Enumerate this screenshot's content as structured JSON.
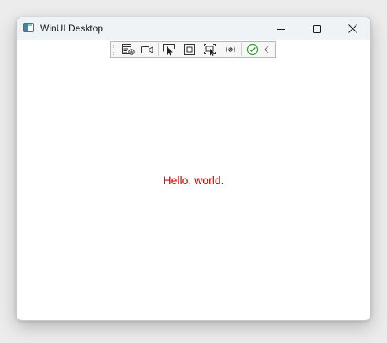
{
  "window": {
    "title": "WinUI Desktop"
  },
  "toolbar": {
    "items": [
      {
        "icon": "live-visual-tree-icon"
      },
      {
        "icon": "record-icon"
      },
      {
        "icon": "select-element-icon"
      },
      {
        "icon": "display-layout-adorners-icon"
      },
      {
        "icon": "track-focus-icon"
      },
      {
        "icon": "binding-failures-icon"
      },
      {
        "icon": "accessibility-check-icon"
      },
      {
        "icon": "collapse-chevron-icon"
      }
    ]
  },
  "content": {
    "message": "Hello, world.",
    "message_color": "#e00000"
  },
  "colors": {
    "titlebar": "#eef3f7",
    "window_background": "#ffffff",
    "check_green": "#2e9d2e"
  }
}
